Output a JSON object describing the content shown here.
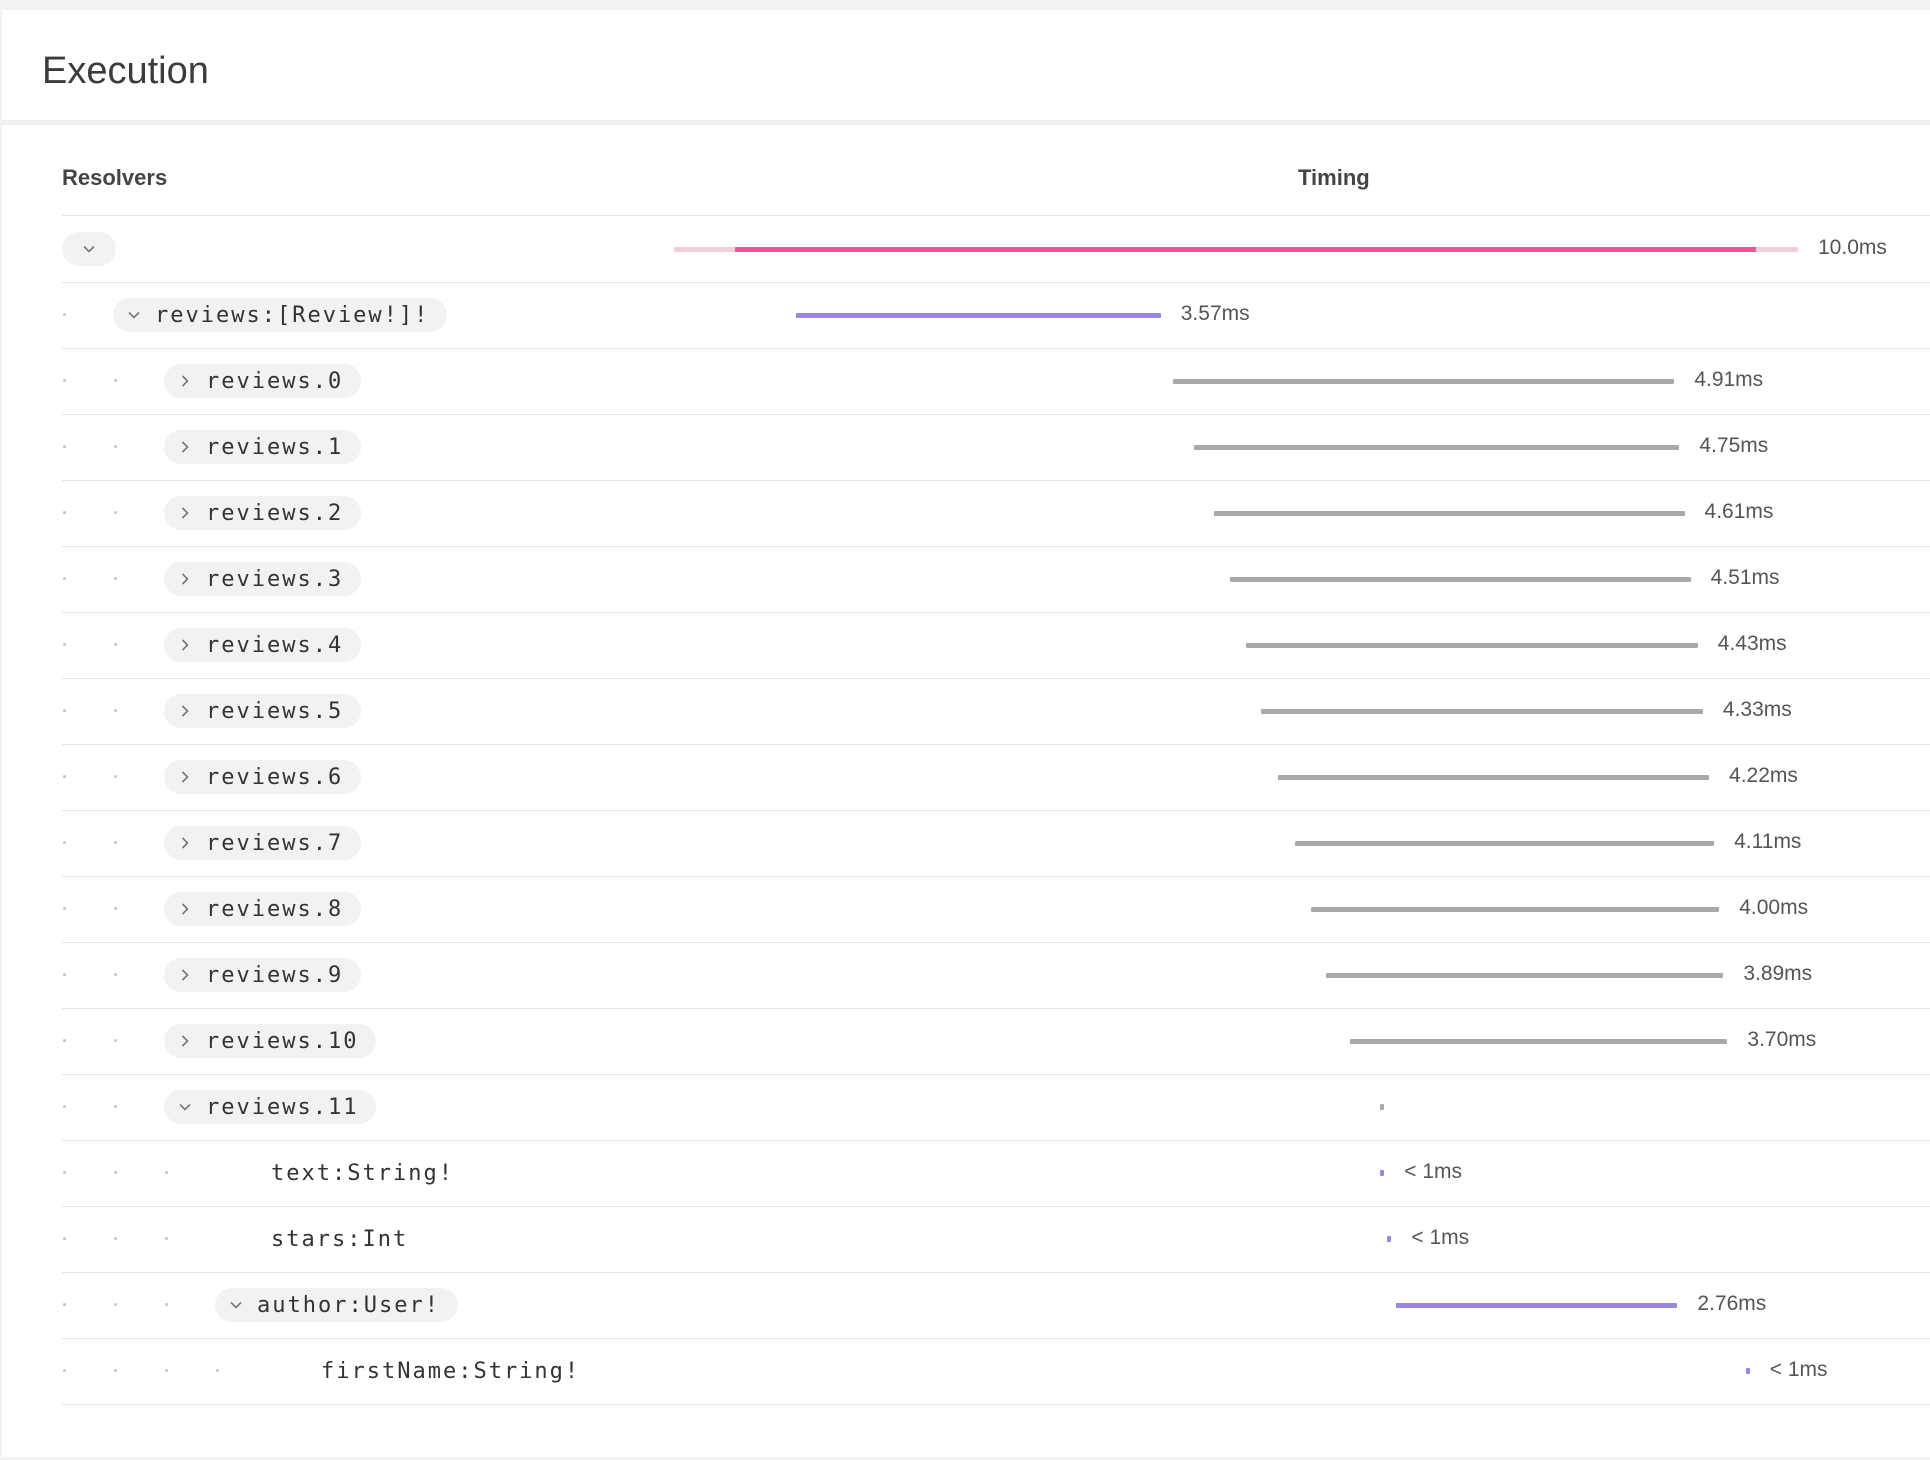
{
  "page": {
    "title": "Execution"
  },
  "columns": {
    "resolvers": "Resolvers",
    "timing": "Timing"
  },
  "colors": {
    "root_bar": "#e5579a",
    "root_bar_bg": "#f1cdd9",
    "field_bar": "#9a86e0",
    "list_item_bar": "#a9a9a9"
  },
  "trace": {
    "total_ms": 10.0,
    "rows": [
      {
        "depth": 0,
        "label": "",
        "expandable": true,
        "expanded": true,
        "kind": "root",
        "start_ms": 0.0,
        "end_ms": 10.0,
        "duration": "10.0ms"
      },
      {
        "depth": 1,
        "label": "reviews:[Review!]!",
        "expandable": true,
        "expanded": true,
        "kind": "field",
        "start_ms": 0.6,
        "end_ms": 4.17,
        "duration": "3.57ms"
      },
      {
        "depth": 2,
        "label": "reviews.0",
        "expandable": true,
        "expanded": false,
        "kind": "item",
        "start_ms": 4.29,
        "end_ms": 9.2,
        "duration": "4.91ms"
      },
      {
        "depth": 2,
        "label": "reviews.1",
        "expandable": true,
        "expanded": false,
        "kind": "item",
        "start_ms": 4.5,
        "end_ms": 9.25,
        "duration": "4.75ms"
      },
      {
        "depth": 2,
        "label": "reviews.2",
        "expandable": true,
        "expanded": false,
        "kind": "item",
        "start_ms": 4.69,
        "end_ms": 9.3,
        "duration": "4.61ms"
      },
      {
        "depth": 2,
        "label": "reviews.3",
        "expandable": true,
        "expanded": false,
        "kind": "item",
        "start_ms": 4.85,
        "end_ms": 9.36,
        "duration": "4.51ms"
      },
      {
        "depth": 2,
        "label": "reviews.4",
        "expandable": true,
        "expanded": false,
        "kind": "item",
        "start_ms": 5.0,
        "end_ms": 9.43,
        "duration": "4.43ms"
      },
      {
        "depth": 2,
        "label": "reviews.5",
        "expandable": true,
        "expanded": false,
        "kind": "item",
        "start_ms": 5.15,
        "end_ms": 9.48,
        "duration": "4.33ms"
      },
      {
        "depth": 2,
        "label": "reviews.6",
        "expandable": true,
        "expanded": false,
        "kind": "item",
        "start_ms": 5.32,
        "end_ms": 9.54,
        "duration": "4.22ms"
      },
      {
        "depth": 2,
        "label": "reviews.7",
        "expandable": true,
        "expanded": false,
        "kind": "item",
        "start_ms": 5.48,
        "end_ms": 9.59,
        "duration": "4.11ms"
      },
      {
        "depth": 2,
        "label": "reviews.8",
        "expandable": true,
        "expanded": false,
        "kind": "item",
        "start_ms": 5.64,
        "end_ms": 9.64,
        "duration": "4.00ms"
      },
      {
        "depth": 2,
        "label": "reviews.9",
        "expandable": true,
        "expanded": false,
        "kind": "item",
        "start_ms": 5.79,
        "end_ms": 9.68,
        "duration": "3.89ms"
      },
      {
        "depth": 2,
        "label": "reviews.10",
        "expandable": true,
        "expanded": false,
        "kind": "item",
        "start_ms": 6.02,
        "end_ms": 9.72,
        "duration": "3.70ms"
      },
      {
        "depth": 2,
        "label": "reviews.11",
        "expandable": true,
        "expanded": true,
        "kind": "item-tiny",
        "start_ms": 6.32,
        "end_ms": 6.36,
        "duration": ""
      },
      {
        "depth": 3,
        "label": "text:String!",
        "expandable": false,
        "expanded": false,
        "kind": "field-tiny",
        "start_ms": 6.32,
        "end_ms": 6.36,
        "duration": "< 1ms"
      },
      {
        "depth": 3,
        "label": "stars:Int",
        "expandable": false,
        "expanded": false,
        "kind": "field-tiny",
        "start_ms": 6.39,
        "end_ms": 6.43,
        "duration": "< 1ms"
      },
      {
        "depth": 3,
        "label": "author:User!",
        "expandable": true,
        "expanded": true,
        "kind": "field",
        "start_ms": 6.47,
        "end_ms": 9.23,
        "duration": "2.76ms"
      },
      {
        "depth": 4,
        "label": "firstName:String!",
        "expandable": false,
        "expanded": false,
        "kind": "field-tiny",
        "start_ms": 9.9,
        "end_ms": 9.94,
        "duration": "< 1ms"
      }
    ]
  }
}
